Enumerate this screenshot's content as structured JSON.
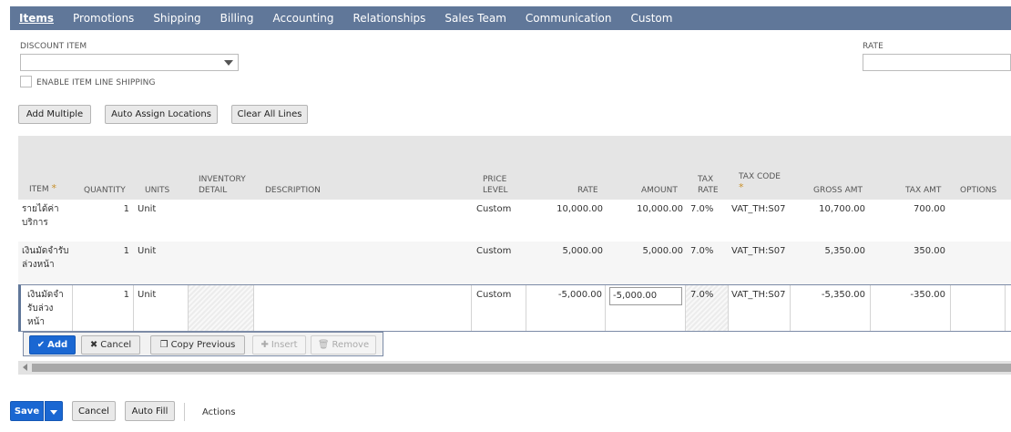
{
  "tabs": [
    {
      "label": "Items",
      "active": true
    },
    {
      "label": "Promotions"
    },
    {
      "label": "Shipping"
    },
    {
      "label": "Billing"
    },
    {
      "label": "Accounting"
    },
    {
      "label": "Relationships"
    },
    {
      "label": "Sales Team"
    },
    {
      "label": "Communication"
    },
    {
      "label": "Custom"
    }
  ],
  "form": {
    "discount_item_label": "DISCOUNT ITEM",
    "discount_item_value": "",
    "rate_label": "RATE",
    "rate_value": "",
    "enable_shipping_label": "ENABLE ITEM LINE SHIPPING",
    "enable_shipping_checked": false
  },
  "toolbar": {
    "add_multiple": "Add Multiple",
    "auto_assign": "Auto Assign Locations",
    "clear_all": "Clear All Lines"
  },
  "table": {
    "headers": {
      "item": "ITEM",
      "quantity": "QUANTITY",
      "units": "UNITS",
      "inventory_detail_1": "INVENTORY",
      "inventory_detail_2": "DETAIL",
      "description": "DESCRIPTION",
      "price_level_1": "PRICE",
      "price_level_2": "LEVEL",
      "rate": "RATE",
      "amount": "AMOUNT",
      "tax_rate_1": "TAX",
      "tax_rate_2": "RATE",
      "tax_code": "TAX CODE",
      "gross_amt": "GROSS AMT",
      "tax_amt": "TAX AMT",
      "options": "OPTIONS",
      "required_star": "*"
    },
    "rows": [
      {
        "item_1": "รายได้ค่า",
        "item_2": "บริการ",
        "item_3": "",
        "quantity": "1",
        "units": "Unit",
        "price_level": "Custom",
        "rate": "10,000.00",
        "amount": "10,000.00",
        "tax_rate": "7.0%",
        "tax_code": "VAT_TH:S07",
        "gross_amt": "10,700.00",
        "tax_amt": "700.00"
      },
      {
        "item_1": "เงินมัดจำรับ",
        "item_2": "ล่วงหน้า",
        "item_3": "",
        "quantity": "1",
        "units": "Unit",
        "price_level": "Custom",
        "rate": "5,000.00",
        "amount": "5,000.00",
        "tax_rate": "7.0%",
        "tax_code": "VAT_TH:S07",
        "gross_amt": "5,350.00",
        "tax_amt": "350.00"
      },
      {
        "item_1": "เงินมัดจำ",
        "item_2": "รับล่วง",
        "item_3": "หน้า",
        "quantity": "1",
        "units": "Unit",
        "price_level": "Custom",
        "rate": "-5,000.00",
        "amount": "-5,000.00",
        "tax_rate": "7.0%",
        "tax_code": "VAT_TH:S07",
        "gross_amt": "-5,350.00",
        "tax_amt": "-350.00"
      }
    ]
  },
  "line_actions": {
    "add": "Add",
    "cancel": "Cancel",
    "copy_previous": "Copy Previous",
    "insert": "Insert",
    "remove": "Remove"
  },
  "footer": {
    "save": "Save",
    "cancel": "Cancel",
    "auto_fill": "Auto Fill",
    "actions": "Actions"
  },
  "colors": {
    "tab_bar": "#607799",
    "primary": "#1a67d2",
    "required_star": "#c8902a"
  }
}
